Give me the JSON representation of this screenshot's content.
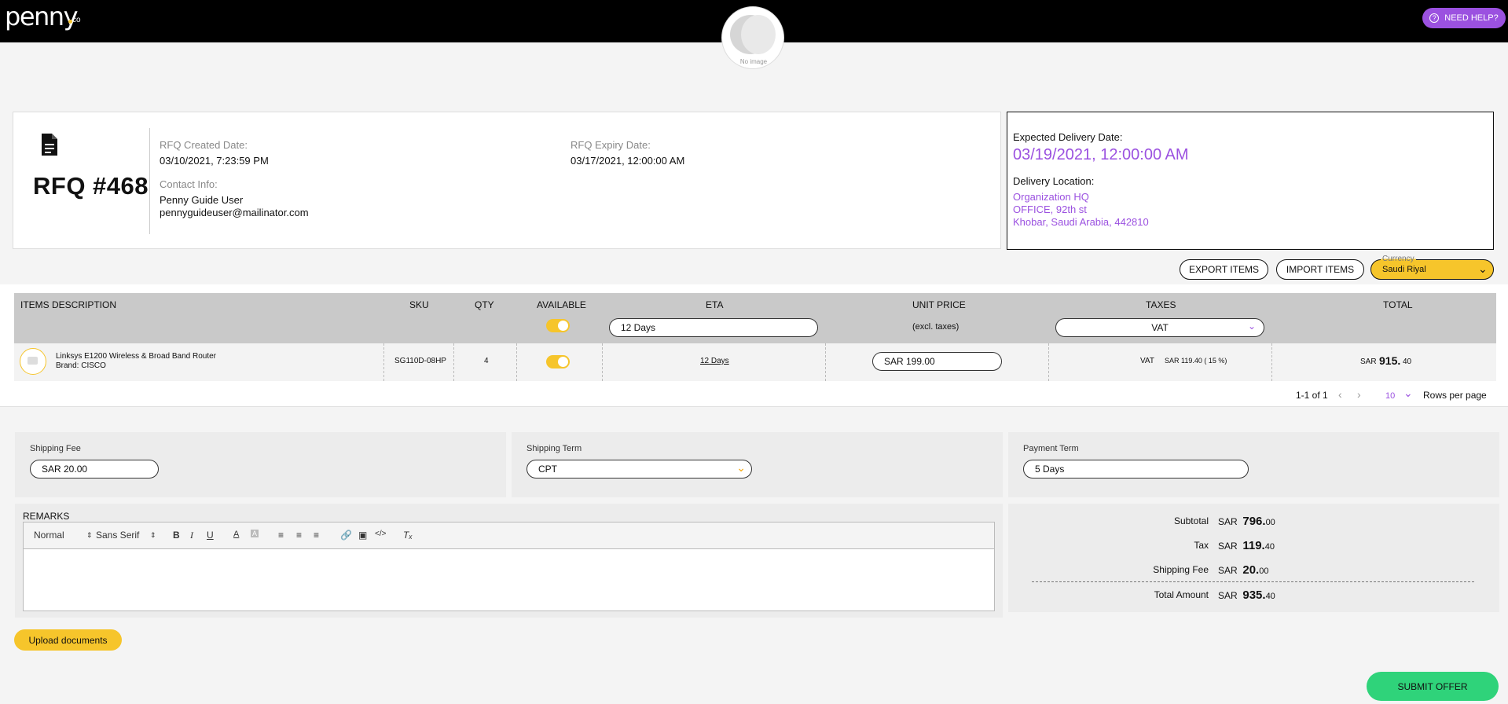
{
  "header": {
    "logo_text": "penny",
    "logo_suffix": "co",
    "help_label": "NEED HELP?",
    "avatar_label": "No image"
  },
  "rfq": {
    "title": "RFQ #468",
    "created_label": "RFQ Created Date:",
    "created_value": "03/10/2021, 7:23:59 PM",
    "expiry_label": "RFQ Expiry Date:",
    "expiry_value": "03/17/2021, 12:00:00 AM",
    "contact_label": "Contact Info:",
    "contact_name": "Penny Guide User",
    "contact_email": "pennyguideuser@mailinator.com"
  },
  "delivery": {
    "date_label": "Expected Delivery Date:",
    "date_value": "03/19/2021, 12:00:00 AM",
    "location_label": "Delivery Location:",
    "location_lines": [
      "Organization HQ",
      "OFFICE, 92th st",
      "Khobar, Saudi Arabia, 442810"
    ]
  },
  "actions": {
    "export_label": "EXPORT ITEMS",
    "import_label": "IMPORT ITEMS",
    "currency_label": "Currency",
    "currency_value": "Saudi Riyal"
  },
  "table": {
    "headers": {
      "description": "ITEMS DESCRIPTION",
      "sku": "SKU",
      "qty": "QTY",
      "available": "AVAILABLE",
      "eta": "ETA",
      "unit_price": "UNIT PRICE",
      "taxes": "TAXES",
      "total": "TOTAL"
    },
    "bulk": {
      "eta_value": "12 Days",
      "unit_price_note": "(excl. taxes)",
      "tax_value": "VAT"
    },
    "rows": [
      {
        "name": "Linksys E1200 Wireless & Broad Band Router",
        "brand": "Brand: CISCO",
        "sku": "SG110D-08HP",
        "qty": "4",
        "available": true,
        "eta": "12 Days",
        "unit_price": "SAR 199.00",
        "tax_name": "VAT",
        "tax_amount": "SAR 119.40 ( 15 %)",
        "total_currency": "SAR",
        "total_int": "915.",
        "total_dec": "40"
      }
    ],
    "pagination": {
      "range": "1-1 of 1",
      "rows_per_page_value": "10",
      "rows_per_page_label": "Rows per page"
    }
  },
  "shipping": {
    "fee_label": "Shipping Fee",
    "fee_value": "SAR 20.00",
    "term_label": "Shipping Term",
    "term_value": "CPT",
    "payment_label": "Payment Term",
    "payment_value": "5 Days"
  },
  "remarks": {
    "label": "REMARKS",
    "format_select": "Normal",
    "font_select": "Sans Serif"
  },
  "totals": {
    "currency": "SAR",
    "subtotal_label": "Subtotal",
    "subtotal_int": "796.",
    "subtotal_dec": "00",
    "tax_label": "Tax",
    "tax_int": "119.",
    "tax_dec": "40",
    "shipping_label": "Shipping Fee",
    "shipping_int": "20.",
    "shipping_dec": "00",
    "total_label": "Total Amount",
    "total_int": "935.",
    "total_dec": "40"
  },
  "footer": {
    "upload_label": "Upload documents",
    "submit_label": "SUBMIT OFFER"
  },
  "colors": {
    "accent_purple": "#9b51e0",
    "accent_yellow": "#f6c52b",
    "submit_green": "#2fd37a"
  }
}
